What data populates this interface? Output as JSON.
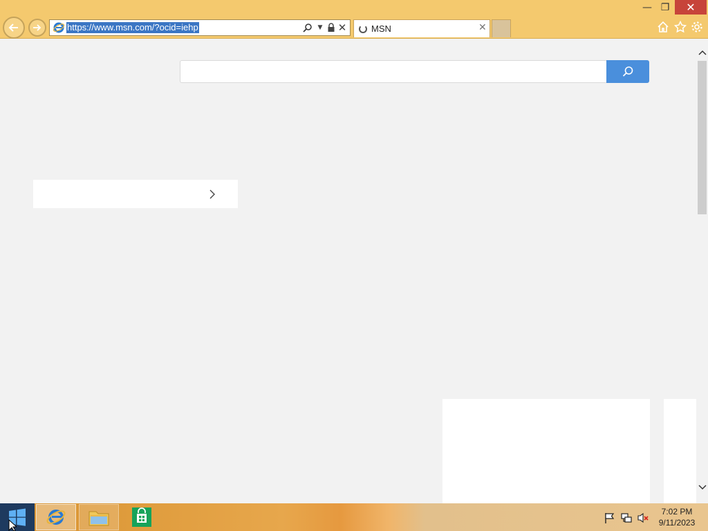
{
  "browser": {
    "address_url": "https://www.msn.com/?ocid=iehp",
    "tab_title": "MSN",
    "window_controls": {
      "minimize": "—",
      "restore": "❐",
      "close": "✕"
    },
    "toolbar_icons": [
      "home-icon",
      "favorites-star-icon",
      "settings-gear-icon"
    ]
  },
  "page": {
    "search_placeholder": ""
  },
  "taskbar": {
    "pinned": [
      "internet-explorer",
      "file-explorer",
      "windows-store"
    ],
    "clock_time": "7:02 PM",
    "clock_date": "9/11/2023"
  },
  "colors": {
    "chrome_accent": "#f4c96e",
    "search_button": "#4a8fdc",
    "url_selection": "#3b76c4",
    "page_background": "#f2f2f2"
  }
}
